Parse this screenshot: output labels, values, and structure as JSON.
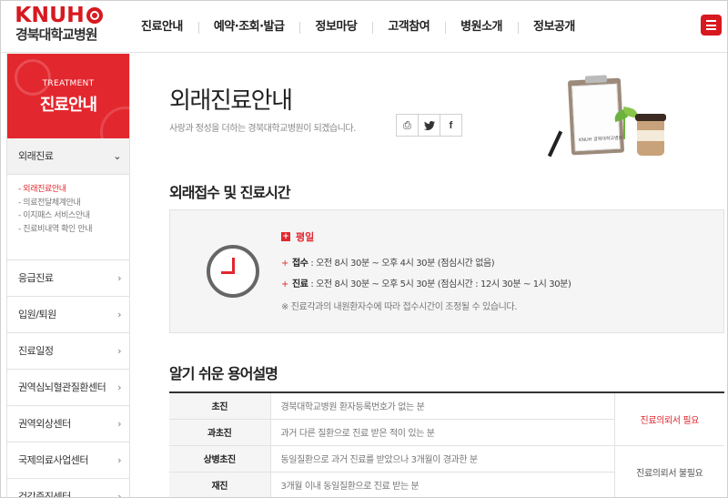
{
  "header": {
    "logo_en": "KNUH",
    "logo_kr": "경북대학교병원",
    "nav": [
      "진료안내",
      "예약·조회·발급",
      "정보마당",
      "고객참여",
      "병원소개",
      "정보공개"
    ]
  },
  "sidebar": {
    "eng_title": "TREATMENT",
    "title": "진료안내",
    "items": [
      {
        "label": "외래진료",
        "arrow": "⌄"
      },
      {
        "label": "응급진료",
        "arrow": "›"
      },
      {
        "label": "입원/퇴원",
        "arrow": "›"
      },
      {
        "label": "진료일정",
        "arrow": "›"
      },
      {
        "label": "권역심뇌혈관질환센터",
        "arrow": "›"
      },
      {
        "label": "권역외상센터",
        "arrow": "›"
      },
      {
        "label": "국제의료사업센터",
        "arrow": "›"
      },
      {
        "label": "건강증진센터",
        "arrow": "›"
      }
    ],
    "sub_items": [
      "- 외래진료안내",
      "- 의료전달체계안내",
      "- 이지패스 서비스안내",
      "- 진료비내역 확인 안내"
    ]
  },
  "main": {
    "title": "외래진료안내",
    "subtitle": "사랑과 정성을 더하는 경북대학교병원이 되겠습니다.",
    "illustration_brand": "KNUH 경북대학교병원",
    "share": {
      "print": "⎙",
      "twitter": "🐦",
      "facebook": "f"
    },
    "section1_title": "외래접수 및 진료시간",
    "hours": {
      "weekday_label": "평일",
      "lines": [
        {
          "label": "접수",
          "text": " : 오전 8시 30분 ~ 오후 4시 30분 (점심시간 없음)"
        },
        {
          "label": "진료",
          "text": " : 오전 8시 30분 ~ 오후 5시 30분 (점심시간 : 12시 30분 ~ 1시 30분)"
        }
      ],
      "note": "※ 진료각과의 내원환자수에 따라 접수시간이 조정될 수 있습니다."
    },
    "section2_title": "알기 쉬운 용어설명",
    "terms": [
      {
        "term": "초진",
        "desc": "경북대학교병원 환자등록번호가 없는 분"
      },
      {
        "term": "과초진",
        "desc": "과거 다른 질환으로 진료 받은 적이 있는 분"
      },
      {
        "term": "상병초진",
        "desc": "동일질환으로 과거 진료를 받았으나 3개월이 경과한 분"
      },
      {
        "term": "재진",
        "desc": "3개월 이내 동일질환으로 진료 받는 분"
      }
    ],
    "term_notes": [
      "진료의뢰서 필요",
      "진료의뢰서 불필요"
    ]
  },
  "colors": {
    "brand_red": "#e3272e"
  }
}
